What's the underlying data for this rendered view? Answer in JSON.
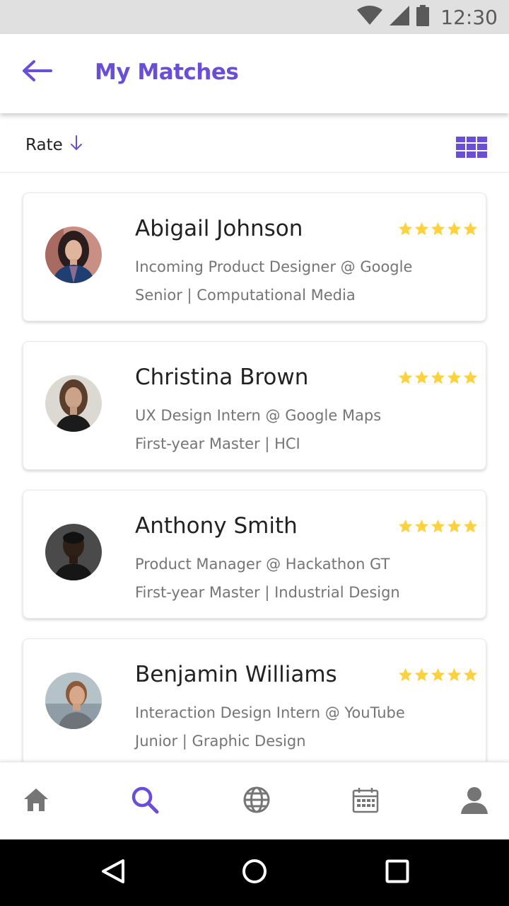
{
  "status_bar": {
    "time": "12:30",
    "icons": [
      "wifi-icon",
      "signal-icon",
      "battery-icon"
    ]
  },
  "app_bar": {
    "title": "My Matches",
    "back_icon": "arrow-left-icon"
  },
  "sort": {
    "label": "Rate",
    "direction_icon": "arrow-down-icon",
    "view_toggle_icon": "grid-view-icon"
  },
  "matches": [
    {
      "name": "Abigail Johnson",
      "role": "Incoming Product Designer @ Google",
      "education": "Senior | Computational Media",
      "rating": 5
    },
    {
      "name": "Christina Brown",
      "role": "UX Design Intern @ Google Maps",
      "education": "First-year Master | HCI",
      "rating": 5
    },
    {
      "name": "Anthony Smith",
      "role": "Product Manager @ Hackathon GT",
      "education": "First-year Master | Industrial Design",
      "rating": 5
    },
    {
      "name": "Benjamin Williams",
      "role": "Interaction Design Intern @ YouTube",
      "education": "Junior | Graphic Design",
      "rating": 5
    }
  ],
  "bottom_nav": {
    "items": [
      "home-icon",
      "search-icon",
      "globe-icon",
      "calendar-icon",
      "profile-icon"
    ],
    "active": "search-icon"
  },
  "system_nav": [
    "back-triangle-icon",
    "home-circle-icon",
    "recents-square-icon"
  ],
  "colors": {
    "accent": "#6a4fd6",
    "star": "#fdd23d",
    "icon_gray": "#757575",
    "status_bar": "#e0e0e0"
  }
}
